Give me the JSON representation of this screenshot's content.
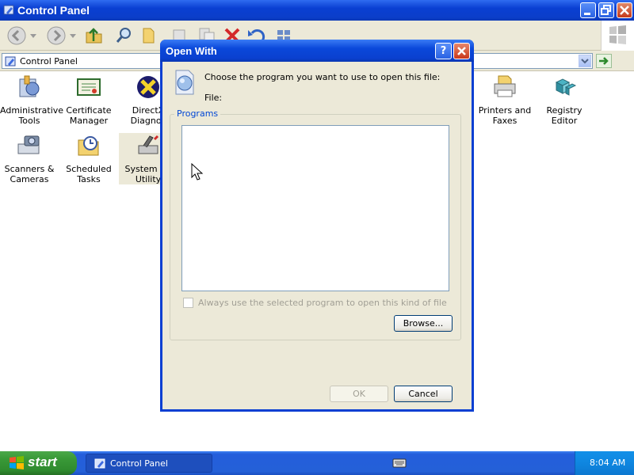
{
  "window": {
    "title": "Control Panel"
  },
  "address_bar": {
    "value": "Control Panel"
  },
  "control_panel_items": [
    {
      "label_line1": "Administrative",
      "label_line2": "Tools"
    },
    {
      "label_line1": "Certificate",
      "label_line2": "Manager"
    },
    {
      "label_line1": "DirectX",
      "label_line2": "Diagnos"
    },
    {
      "label_line1": "Printers and",
      "label_line2": "Faxes"
    },
    {
      "label_line1": "Registry Editor",
      "label_line2": ""
    },
    {
      "label_line1": "Scanners &",
      "label_line2": "Cameras"
    },
    {
      "label_line1": "Scheduled",
      "label_line2": "Tasks"
    },
    {
      "label_line1": "System Co",
      "label_line2": "Utility"
    }
  ],
  "dialog": {
    "title": "Open With",
    "help_label": "?",
    "prompt": "Choose the program you want to use to open this file:",
    "file_label": "File:",
    "programs_group_label": "Programs",
    "always_use_label": "Always use the selected program to open this kind of file",
    "always_use_checked": false,
    "browse_label": "Browse...",
    "ok_label": "OK",
    "cancel_label": "Cancel"
  },
  "taskbar": {
    "start_label": "start",
    "task_label": "Control Panel",
    "clock": "8:04 AM"
  },
  "colors": {
    "titlebar_blue": "#0a3fd2",
    "start_green": "#3a9a38",
    "dialog_face": "#ece9d8",
    "group_label_blue": "#0046d5"
  }
}
